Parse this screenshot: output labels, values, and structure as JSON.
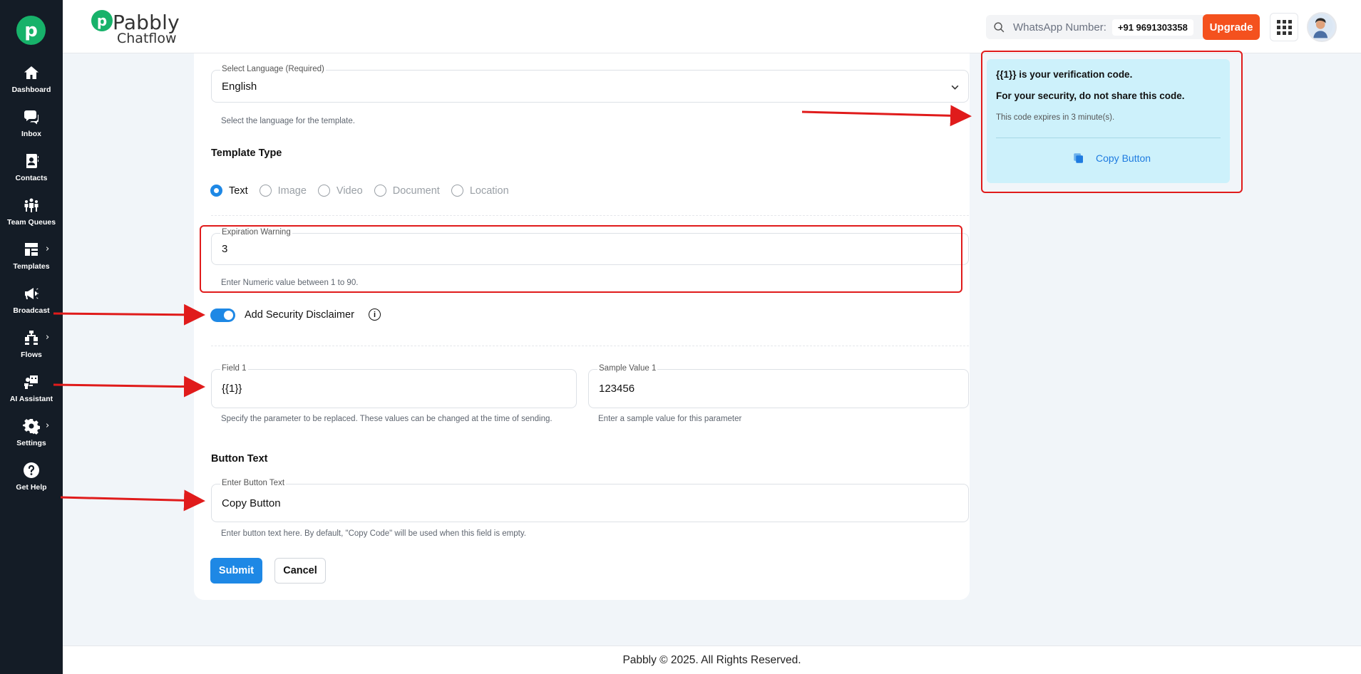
{
  "sidebar": {
    "items": [
      {
        "label": "Dashboard",
        "icon": "home-icon"
      },
      {
        "label": "Inbox",
        "icon": "chat-icon"
      },
      {
        "label": "Contacts",
        "icon": "contact-book-icon"
      },
      {
        "label": "Team Queues",
        "icon": "team-icon"
      },
      {
        "label": "Templates",
        "icon": "templates-icon"
      },
      {
        "label": "Broadcast",
        "icon": "megaphone-icon"
      },
      {
        "label": "Flows",
        "icon": "flows-icon"
      },
      {
        "label": "AI Assistant",
        "icon": "ai-assistant-icon"
      },
      {
        "label": "Settings",
        "icon": "gear-icon"
      },
      {
        "label": "Get Help",
        "icon": "help-icon"
      }
    ]
  },
  "header": {
    "brand_top": "Pabbly",
    "brand_sub": "Chatflow",
    "whatsapp_label": "WhatsApp Number:",
    "whatsapp_number": "+91 9691303358",
    "upgrade_label": "Upgrade"
  },
  "form": {
    "language": {
      "label": "Select Language (Required)",
      "value": "English",
      "helper": "Select the language for the template."
    },
    "template_type": {
      "title": "Template Type",
      "options": [
        "Text",
        "Image",
        "Video",
        "Document",
        "Location"
      ],
      "selected": "Text"
    },
    "expiration": {
      "label": "Expiration Warning",
      "value": "3",
      "helper": "Enter Numeric value between 1 to 90."
    },
    "security_disclaimer": {
      "label": "Add Security Disclaimer",
      "enabled": true
    },
    "field1": {
      "label": "Field 1",
      "value": "{{1}}",
      "helper": "Specify the parameter to be replaced. These values can be changed at the time of sending."
    },
    "sample1": {
      "label": "Sample Value 1",
      "value": "123456",
      "helper": "Enter a sample value for this parameter"
    },
    "button_text": {
      "title": "Button Text",
      "label": "Enter Button Text",
      "value": "Copy Button",
      "helper": "Enter button text here. By default, \"Copy Code\" will be used when this field is empty."
    },
    "submit_label": "Submit",
    "cancel_label": "Cancel"
  },
  "preview": {
    "line1": "{{1}} is your verification code.",
    "line2": "For your security, do not share this code.",
    "line3": "This code expires in 3 minute(s).",
    "button_label": "Copy Button"
  },
  "footer": {
    "text": "Pabbly © 2025. All Rights Reserved."
  },
  "colors": {
    "sidebar_bg": "#141c26",
    "brand_green": "#17b26a",
    "primary_blue": "#1e88e5",
    "upgrade_orange": "#f4511e",
    "preview_bg": "#cdf1fb",
    "annotation_red": "#e01b1b"
  }
}
